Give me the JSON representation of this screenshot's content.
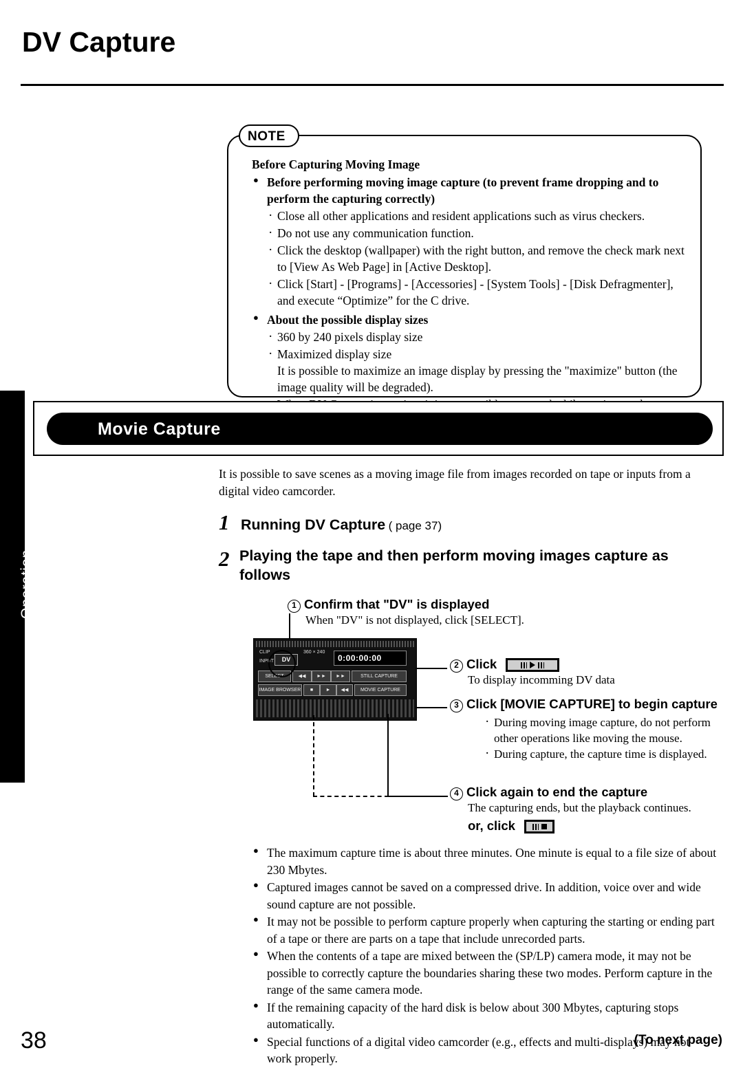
{
  "page": {
    "title": "DV Capture",
    "side_tab_label": "Operation",
    "page_number": "38",
    "next_page": "(To next page)"
  },
  "note": {
    "badge": "NOTE",
    "heading": "Before Capturing Moving Image",
    "bullet1": {
      "text": "Before performing moving image capture (to prevent frame dropping and to perform the capturing correctly)",
      "items": [
        "Close all other applications and resident applications such as virus checkers.",
        "Do not use any communication function.",
        "Click the desktop (wallpaper) with the right button, and remove the check mark next to [View As Web Page] in [Active Desktop].",
        "Click [Start] - [Programs] - [Accessories] - [System Tools] - [Disk Defragmenter], and execute “Optimize” for the C drive."
      ]
    },
    "bullet2": {
      "text": "About the possible display sizes",
      "items": [
        "360 by 240 pixels display size",
        "Maximized display size"
      ],
      "subtext": "It is possible to maximize an image display by pressing the \"maximize\" button (the image quality will be degraded).",
      "item3": "When DV Capture is running, it is not possible to enter the hibernation mode."
    }
  },
  "section": {
    "banner": "Movie Capture",
    "intro": "It is possible to save scenes as a moving image file from images recorded on tape or inputs from a digital video camcorder."
  },
  "steps": {
    "step1_num": "1",
    "step1_head": "Running DV Capture",
    "step1_ref": "( page 37)",
    "step2_num": "2",
    "step2_head": "Playing the tape and then perform moving images capture as follows"
  },
  "callouts": {
    "c1_num": "1",
    "c1_title": "Confirm that \"DV\" is displayed",
    "c1_body": "When \"DV\" is not displayed, click [SELECT].",
    "c2_num": "2",
    "c2_title": "Click",
    "c2_body": "To display incomming DV data",
    "c3_num": "3",
    "c3_title": "Click [MOVIE CAPTURE] to begin capture",
    "c3_items": [
      "During moving image capture, do not perform other operations like moving the mouse.",
      "During capture, the capture time is displayed."
    ],
    "c4_num": "4",
    "c4_title": "Click again to end the capture",
    "c4_body": "The capturing ends, but the playback continues.",
    "c4_or": "or, click"
  },
  "device": {
    "counter": "0:00:00:00",
    "dv_label": "DV",
    "left_line1": "CLIP",
    "left_line2": "INPUT",
    "size_label": "360 × 240",
    "buttons_row1": [
      "SELECT",
      "◀◀",
      "►►",
      "►►",
      "STILL CAPTURE"
    ],
    "buttons_row2": [
      "IMAGE BROWSER",
      "■",
      "►",
      "◀◀",
      "MOVIE CAPTURE"
    ]
  },
  "final_notes": [
    "The maximum capture time is about three minutes. One minute is equal to a file size of about 230 Mbytes.",
    "Captured images cannot be saved on a compressed drive. In addition, voice over and wide sound capture are not possible.",
    "It may not be possible to perform capture properly when capturing the starting or ending part of a tape or there are parts on a tape that include unrecorded parts.",
    "When the contents of a tape are mixed between the (SP/LP) camera mode, it may not be possible to correctly capture the boundaries sharing these two modes. Perform capture in the range of the same camera mode.",
    "If the remaining capacity of the hard disk is below about 300 Mbytes, capturing stops automatically.",
    "Special functions of a digital video camcorder (e.g., effects and multi-displays) may not work properly."
  ]
}
